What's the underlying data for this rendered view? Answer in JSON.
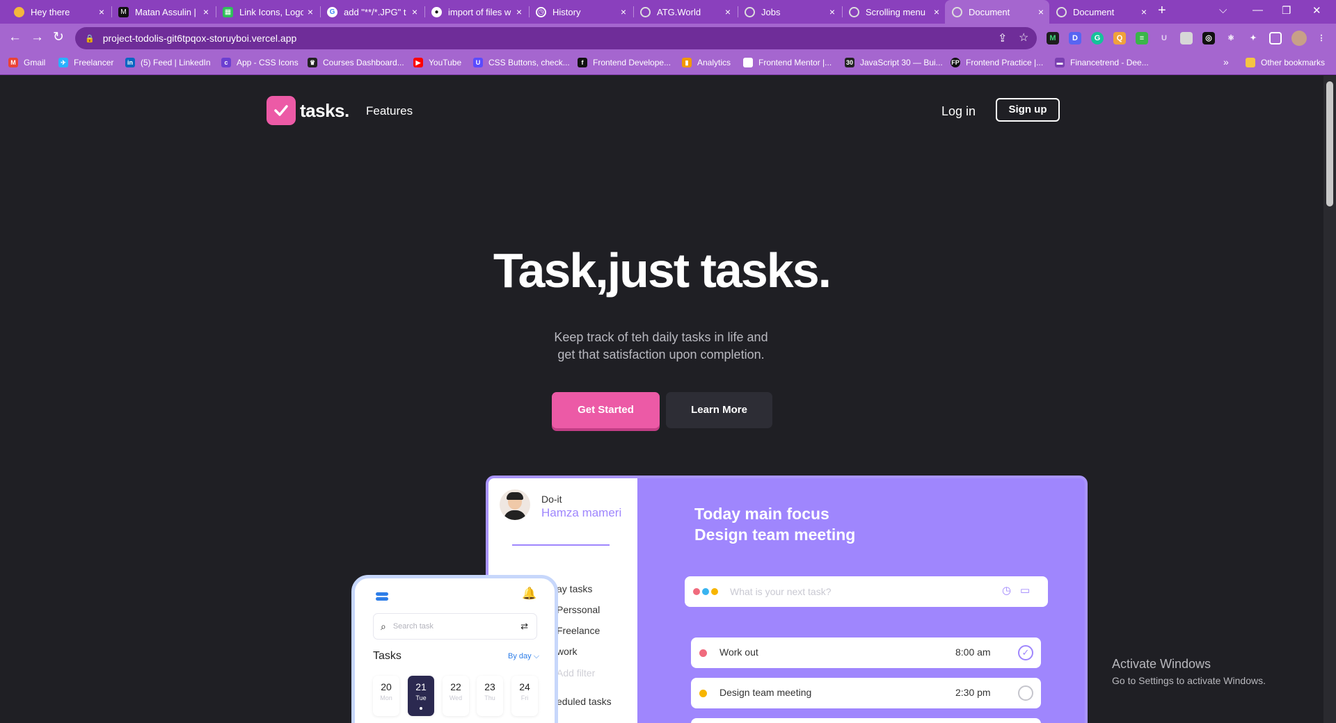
{
  "browser": {
    "tabs": [
      {
        "title": "Hey there",
        "icon": "circle-yellow",
        "color": "#f4b73c"
      },
      {
        "title": "Matan Assulin |",
        "icon": "logo-m",
        "color": "#111111"
      },
      {
        "title": "Link Icons, Logo",
        "icon": "grid-green",
        "color": "#2fbf5a"
      },
      {
        "title": "add \"**/*.JPG\" t",
        "icon": "google-g",
        "color": "#ffffff"
      },
      {
        "title": "import of files w",
        "icon": "github",
        "color": "#111111"
      },
      {
        "title": "History",
        "icon": "history",
        "color": "#8a40bd"
      },
      {
        "title": "ATG.World",
        "icon": "globe",
        "color": "#8a40bd"
      },
      {
        "title": "Jobs",
        "icon": "globe",
        "color": "#8a40bd"
      },
      {
        "title": "Scrolling menu",
        "icon": "globe",
        "color": "#8a40bd"
      },
      {
        "title": "Document",
        "icon": "globe",
        "color": "#a566cf",
        "active": true
      },
      {
        "title": "Document",
        "icon": "globe",
        "color": "#8a40bd"
      }
    ],
    "url": "project-todolis-git6tpqox-storuyboi.vercel.app",
    "bookmarks": [
      {
        "label": "Gmail",
        "icon": "gmail",
        "color": "#ea4335"
      },
      {
        "label": "Freelancer",
        "icon": "freelancer",
        "color": "#29b2fe"
      },
      {
        "label": "(5) Feed | LinkedIn",
        "icon": "linkedin",
        "color": "#0a66c2"
      },
      {
        "label": "App - CSS Icons",
        "icon": "css-icons",
        "color": "#6c3fd1"
      },
      {
        "label": "Courses Dashboard...",
        "icon": "crown",
        "color": "#222222"
      },
      {
        "label": "YouTube",
        "icon": "youtube",
        "color": "#ff0000"
      },
      {
        "label": "CSS Buttons, check...",
        "icon": "css-buttons",
        "color": "#5a4bff"
      },
      {
        "label": "Frontend Develope...",
        "icon": "frontend",
        "color": "#111111"
      },
      {
        "label": "Analytics",
        "icon": "analytics",
        "color": "#f29900"
      },
      {
        "label": "Frontend Mentor |...",
        "icon": "frontend-mentor",
        "color": "#ffffff"
      },
      {
        "label": "JavaScript 30 — Bui...",
        "icon": "js30",
        "color": "#222222"
      },
      {
        "label": "Frontend Practice |...",
        "icon": "fp",
        "color": "#111111"
      },
      {
        "label": "Financetrend - Dee...",
        "icon": "financetrend",
        "color": "#7a3fb0"
      }
    ],
    "other_bookmarks": "Other bookmarks"
  },
  "site": {
    "logo_text": "tasks.",
    "nav_features": "Features",
    "login": "Log in",
    "signup": "Sign up",
    "hero_title": "Task,just tasks.",
    "subtitle_line1": "Keep track of teh daily tasks in life and",
    "subtitle_line2": "get that satisfaction upon completion.",
    "btn_get_started": "Get Started",
    "btn_learn_more": "Learn More",
    "accent": "#ec5aa6",
    "app_color": "#9f86fd"
  },
  "desktop_app": {
    "brand": "Do-it",
    "user": "Hamza mameri",
    "sidebar_items": [
      "ay tasks",
      "Perssonal",
      "Freelance",
      "work",
      "Add filter",
      "eduled tasks"
    ],
    "focus_title": "Today main focus",
    "focus_task": "Design team meeting",
    "input_placeholder": "What is your next task?",
    "tasks": [
      {
        "name": "Work out",
        "time": "8:00 am",
        "done": true,
        "color": "#f06b7d"
      },
      {
        "name": "Design team meeting",
        "time": "2:30 pm",
        "done": false,
        "color": "#f7b500"
      }
    ]
  },
  "mobile_app": {
    "search_placeholder": "Search task",
    "tasks_title": "Tasks",
    "by_day": "By day",
    "days": [
      {
        "num": "20",
        "wd": "Mon"
      },
      {
        "num": "21",
        "wd": "Tue",
        "selected": true
      },
      {
        "num": "22",
        "wd": "Wed"
      },
      {
        "num": "23",
        "wd": "Thu"
      },
      {
        "num": "24",
        "wd": "Fri"
      }
    ]
  },
  "watermark": {
    "line1": "Activate Windows",
    "line2": "Go to Settings to activate Windows."
  }
}
